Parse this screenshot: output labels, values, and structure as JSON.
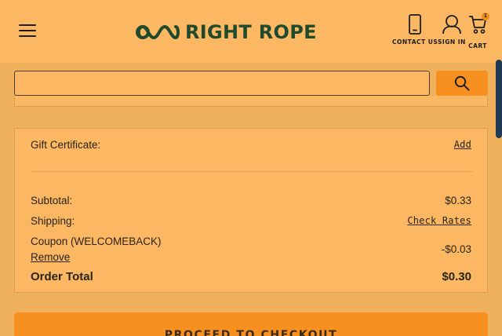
{
  "header": {
    "brand": "RIGHT ROPE",
    "links": {
      "contact": "CONTACT US",
      "signin": "SIGN IN",
      "cart": "CART",
      "cart_count": "1"
    }
  },
  "search": {
    "value": "",
    "placeholder": ""
  },
  "totals": {
    "gift_certificate_label": "Gift Certificate:",
    "gift_certificate_action": "Add",
    "subtotal_label": "Subtotal:",
    "subtotal_value": "$0.33",
    "shipping_label": "Shipping:",
    "shipping_action": "Check Rates",
    "coupon_label": "Coupon (WELCOMEBACK)",
    "coupon_remove": "Remove",
    "coupon_value": "-$0.03",
    "order_total_label": "Order Total",
    "order_total_value": "$0.30"
  },
  "checkout": {
    "label": "PROCEED TO CHECKOUT"
  },
  "colors": {
    "header_bg": "#fbb762",
    "page_bg": "#f0b15d",
    "accent": "#f7901e",
    "brand_green": "#1f4a2e"
  },
  "icons": [
    "menu-icon",
    "logo-icon",
    "phone-icon",
    "user-icon",
    "cart-icon",
    "search-icon"
  ]
}
